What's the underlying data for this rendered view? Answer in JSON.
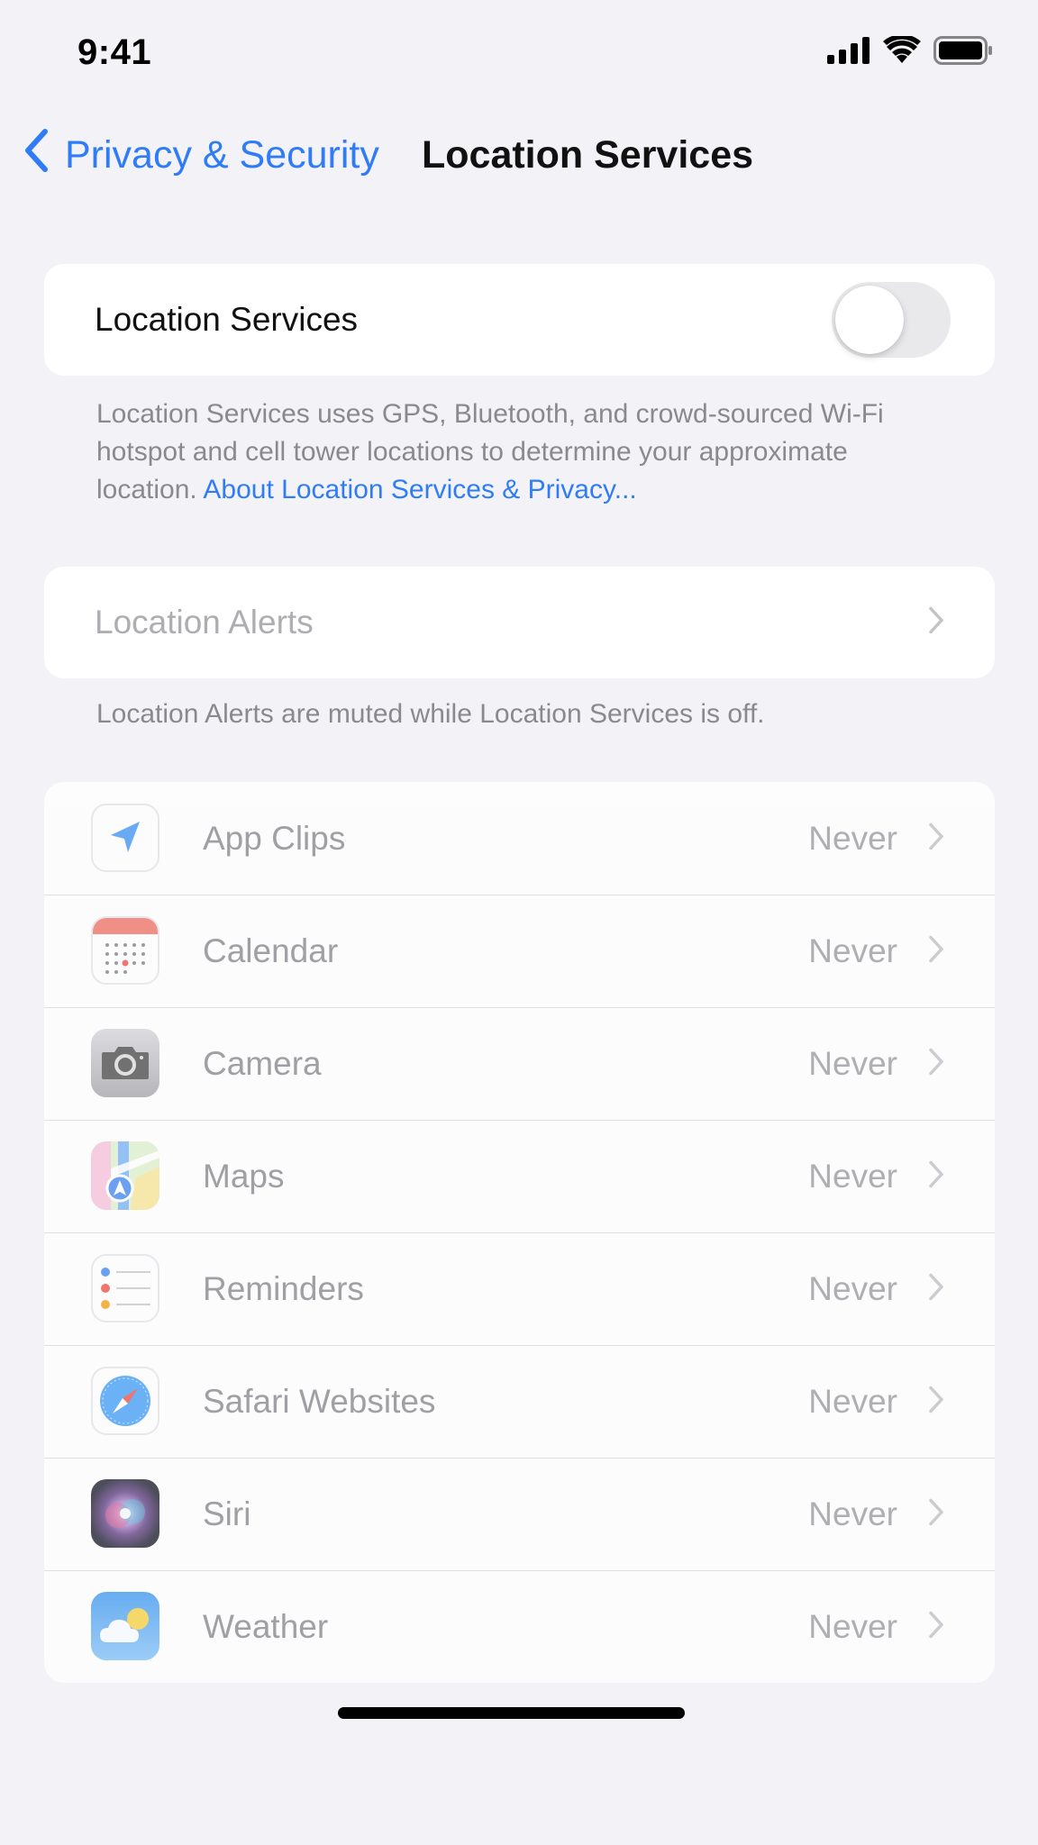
{
  "status_bar": {
    "time": "9:41"
  },
  "nav": {
    "back_label": "Privacy & Security",
    "title": "Location Services"
  },
  "location_toggle": {
    "label": "Location Services",
    "enabled": false
  },
  "description": {
    "text": "Location Services uses GPS, Bluetooth, and crowd-sourced Wi-Fi hotspot and cell tower locations to determine your approximate location. ",
    "link": "About Location Services & Privacy..."
  },
  "alerts": {
    "label": "Location Alerts",
    "footnote": "Location Alerts are muted while Location Services is off."
  },
  "apps": [
    {
      "name": "App Clips",
      "value": "Never",
      "icon": "location-arrow-icon"
    },
    {
      "name": "Calendar",
      "value": "Never",
      "icon": "calendar-icon"
    },
    {
      "name": "Camera",
      "value": "Never",
      "icon": "camera-icon"
    },
    {
      "name": "Maps",
      "value": "Never",
      "icon": "maps-icon"
    },
    {
      "name": "Reminders",
      "value": "Never",
      "icon": "reminders-icon"
    },
    {
      "name": "Safari Websites",
      "value": "Never",
      "icon": "safari-icon"
    },
    {
      "name": "Siri",
      "value": "Never",
      "icon": "siri-icon"
    },
    {
      "name": "Weather",
      "value": "Never",
      "icon": "weather-icon"
    }
  ],
  "colors": {
    "accent": "#2f7cf6",
    "background": "#f2f2f7",
    "secondary_text": "#8a8a8e"
  }
}
